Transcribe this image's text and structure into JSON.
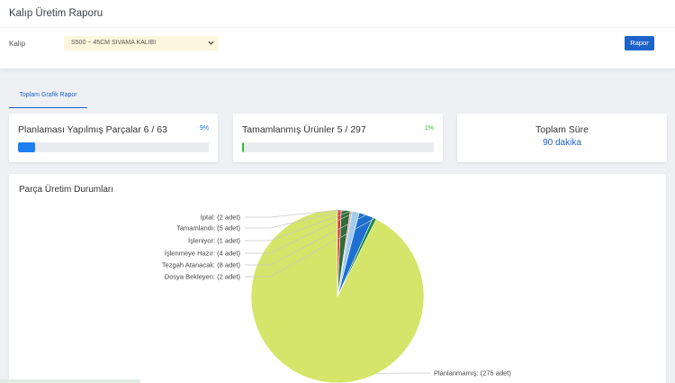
{
  "header": {
    "title": "Kalıp Üretim Raporu",
    "mold_label": "Kalıp",
    "mold_selected": "S500 ~ 45CM SIVAMA KALIBI",
    "report_button": "Rapor"
  },
  "tabs": [
    {
      "label": "Toplam Grafik Rapor",
      "active": true
    }
  ],
  "stats": {
    "planned": {
      "title": "Planlaması Yapılmış Parçalar 6 / 63",
      "percent_label": "9%",
      "progress": 0.09,
      "color": "#1d7ff0"
    },
    "completed": {
      "title": "Tamamlanmış Ürünler 5 / 297",
      "percent_label": "1%",
      "progress": 0.01,
      "color": "#2fbf3a"
    },
    "total_time": {
      "title": "Toplam Süre",
      "value": "90 dakika"
    }
  },
  "chart": {
    "title": "Parça Üretim Durumları"
  },
  "chart_data": {
    "type": "pie",
    "title": "Parça Üretim Durumları",
    "slices": [
      {
        "label": "Planlanmamış: (275 adet)",
        "value": 275,
        "color": "#d4e56a"
      },
      {
        "label": "Dosya Bekleyen: (2 adet)",
        "value": 2,
        "color": "#1f8a3c"
      },
      {
        "label": "Tezgah Atanacak: (8 adet)",
        "value": 8,
        "color": "#1d6fd1"
      },
      {
        "label": "İşlenmeye Hazır: (4 adet)",
        "value": 4,
        "color": "#9ecbf0"
      },
      {
        "label": "İşleniyor: (1 adet)",
        "value": 1,
        "color": "#f29aa3"
      },
      {
        "label": "Tamamlandı: (5 adet)",
        "value": 5,
        "color": "#2f6d3a"
      },
      {
        "label": "İptal: (2 adet)",
        "value": 2,
        "color": "#e23a2c"
      }
    ]
  }
}
